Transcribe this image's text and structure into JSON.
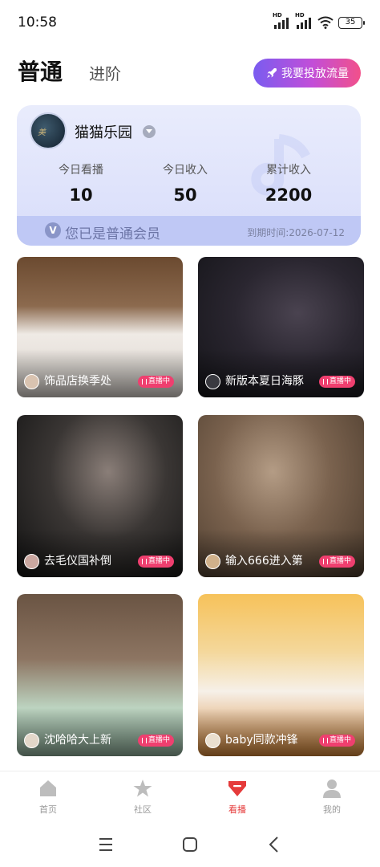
{
  "status_bar": {
    "time": "10:58",
    "signal1_label": "HD",
    "signal2_label": "HD",
    "battery": "35"
  },
  "header": {
    "tab_normal": "普通",
    "tab_advanced": "进阶",
    "promo_button": "我要投放流量"
  },
  "member_card": {
    "avatar_text": "美",
    "name": "猫猫乐园",
    "stats": [
      {
        "label": "今日看播",
        "value": "10"
      },
      {
        "label": "今日收入",
        "value": "50"
      },
      {
        "label": "累计收入",
        "value": "2200"
      }
    ],
    "vip_badge": "V",
    "vip_text": "您已是普通会员",
    "expire_text": "到期时间:2026-07-12"
  },
  "live_tiles": [
    {
      "title": "饰品店换季处",
      "live_label": "直播中",
      "bg": "#5a3b26",
      "bg2": "#e9e6e2"
    },
    {
      "title": "新版本夏日海豚",
      "live_label": "直播中",
      "bg": "#1f1f24",
      "bg2": "#4a4350"
    },
    {
      "title": "去毛仪国补倒",
      "live_label": "直播中",
      "bg": "#1a1a1a",
      "bg2": "#7b6f6a"
    },
    {
      "title": "输入666进入第",
      "live_label": "直播中",
      "bg": "#6b5240",
      "bg2": "#b39a83"
    },
    {
      "title": "沈哈哈大上新",
      "live_label": "直播中",
      "bg": "#5e4a3a",
      "bg2": "#c7d9c8"
    },
    {
      "title": "baby同款冲锋",
      "live_label": "直播中",
      "bg": "#f2b54a",
      "bg2": "#f7efe4"
    }
  ],
  "bottom_nav": [
    {
      "label": "首页",
      "icon": "home-icon",
      "active": false
    },
    {
      "label": "社区",
      "icon": "star-icon",
      "active": false
    },
    {
      "label": "看播",
      "icon": "watch-live-icon",
      "active": true
    },
    {
      "label": "我的",
      "icon": "profile-icon",
      "active": false
    }
  ],
  "colors": {
    "accent": "#e53a3a",
    "live_badge": "#ef3f6f",
    "promo_start": "#7a5cf0",
    "promo_end": "#f2508a",
    "card_bg": "#e4e8fc"
  }
}
